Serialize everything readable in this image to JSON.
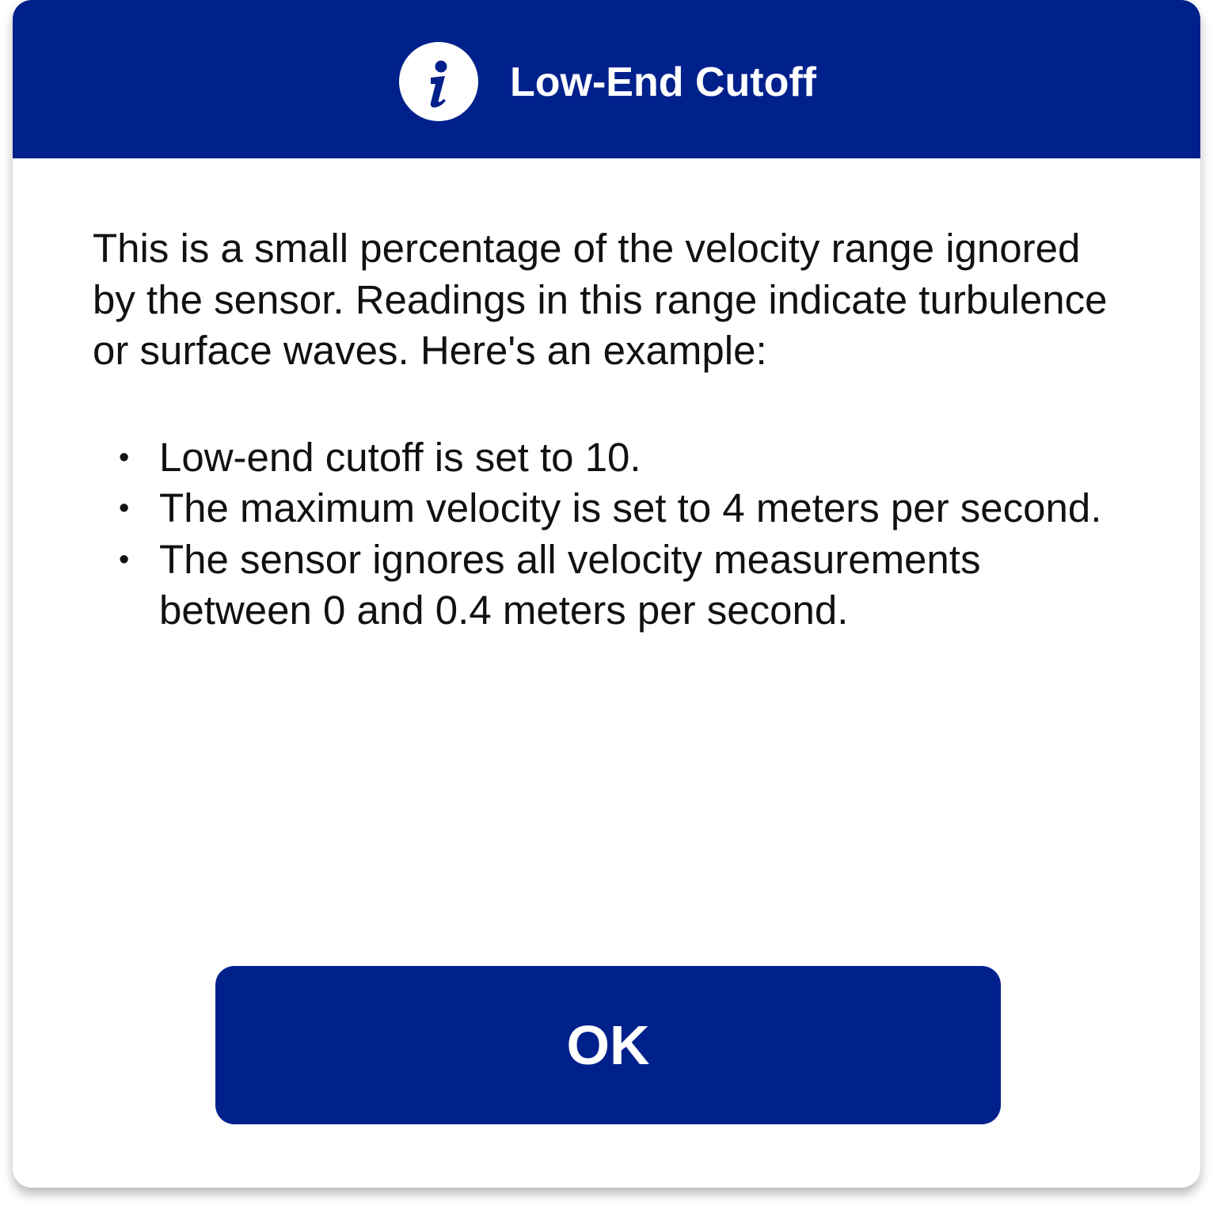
{
  "dialog": {
    "title": "Low-End Cutoff",
    "icon": "info-icon",
    "intro": "This is a small percentage of the velocity range ignored by the sensor. Readings in this range indicate turbulence or surface waves. Here's an example:",
    "examples": [
      "Low-end cutoff is set to 10.",
      "The maximum velocity is set to 4 meters per second.",
      "The sensor ignores all velocity measurements between 0 and 0.4 meters per second."
    ],
    "ok_label": "OK"
  },
  "colors": {
    "primary": "#00218c",
    "text": "#111111",
    "background": "#ffffff"
  }
}
